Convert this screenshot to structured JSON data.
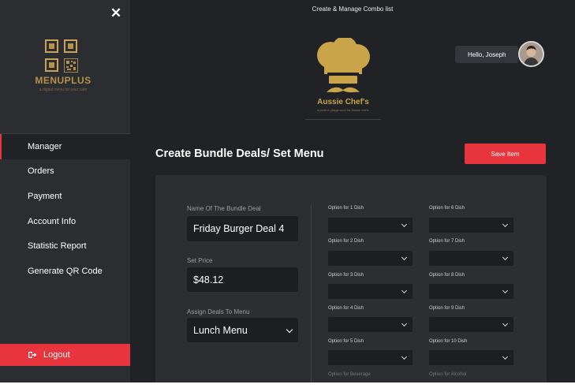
{
  "sidebar": {
    "logo_word": "MENUPLUS",
    "logo_tagline": "a digital menu for your cafe",
    "items": [
      {
        "label": "Manager",
        "active": true
      },
      {
        "label": "Orders"
      },
      {
        "label": "Payment"
      },
      {
        "label": "Account Info"
      },
      {
        "label": "Statistic Report"
      },
      {
        "label": "Generate QR Code"
      }
    ],
    "logout_label": "Logout"
  },
  "header": {
    "caption": "Create & Manage Combo list",
    "greeting": "Hello, Joseph",
    "brand_name": "Aussie Chef's",
    "brand_tagline": "a perfect playground for Aussie chefs"
  },
  "main": {
    "title": "Create Bundle Deals/ Set Menu",
    "save_label": "Save Item"
  },
  "form": {
    "bundle_name_label": "Name Of The Bundle Deal",
    "bundle_name_value": "Friday Burger Deal 4",
    "price_label": "Set Price",
    "price_value": "$48.12",
    "assign_label": "Assign Deals To Menu",
    "assign_value": "Lunch Menu"
  },
  "options": {
    "left": [
      "Option for 1 Dish",
      "Option for 2 Dish",
      "Option for 3 Dish",
      "Option for 4 Dish",
      "Option for 5 Dish"
    ],
    "right": [
      "Option for 6 Dish",
      "Option for 7 Dish",
      "Option for 8 Dish",
      "Option for 9 Dish",
      "Option for 10 Dish"
    ],
    "beverage": "Option for Beverage",
    "alcohol": "Option for Alcohol"
  },
  "colors": {
    "accent": "#e8343c",
    "gold": "#c9a448",
    "background": "#202225",
    "sidebar": "#2b2d30"
  }
}
